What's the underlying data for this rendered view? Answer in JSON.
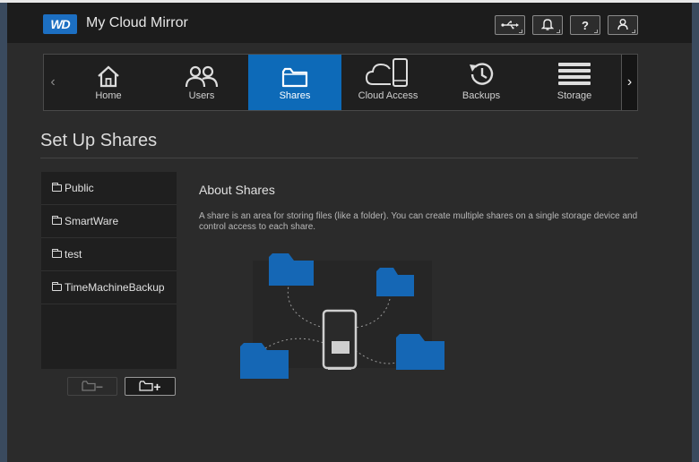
{
  "header": {
    "logo_text": "WD",
    "app_title": "My Cloud Mirror",
    "buttons": [
      {
        "name": "usb",
        "glyph": "⭍",
        "icon": "usb-icon"
      },
      {
        "name": "alerts",
        "glyph": "🔔",
        "icon": "bell-icon"
      },
      {
        "name": "help",
        "glyph": "?",
        "icon": "help-icon"
      },
      {
        "name": "user",
        "glyph": "",
        "icon": "user-icon"
      }
    ]
  },
  "nav": {
    "prev_glyph": "‹",
    "next_glyph": "›",
    "items": [
      {
        "label": "Home",
        "icon": "home-icon",
        "active": false
      },
      {
        "label": "Users",
        "icon": "users-icon",
        "active": false
      },
      {
        "label": "Shares",
        "icon": "folder-icon",
        "active": true
      },
      {
        "label": "Cloud Access",
        "icon": "cloud-access-icon",
        "active": false
      },
      {
        "label": "Backups",
        "icon": "backups-icon",
        "active": false
      },
      {
        "label": "Storage",
        "icon": "storage-icon",
        "active": false
      }
    ]
  },
  "page": {
    "title": "Set Up Shares"
  },
  "shares": {
    "items": [
      "Public",
      "SmartWare",
      "test",
      "TimeMachineBackup"
    ],
    "remove_glyph": "−",
    "add_glyph": "+"
  },
  "about": {
    "title": "About Shares",
    "text": "A share is an area for storing files (like a folder). You can create multiple shares on a single storage device and control access to each share."
  },
  "colors": {
    "accent": "#0d6ab8",
    "background": "#2b2b2b",
    "header": "#1c1c1c"
  }
}
